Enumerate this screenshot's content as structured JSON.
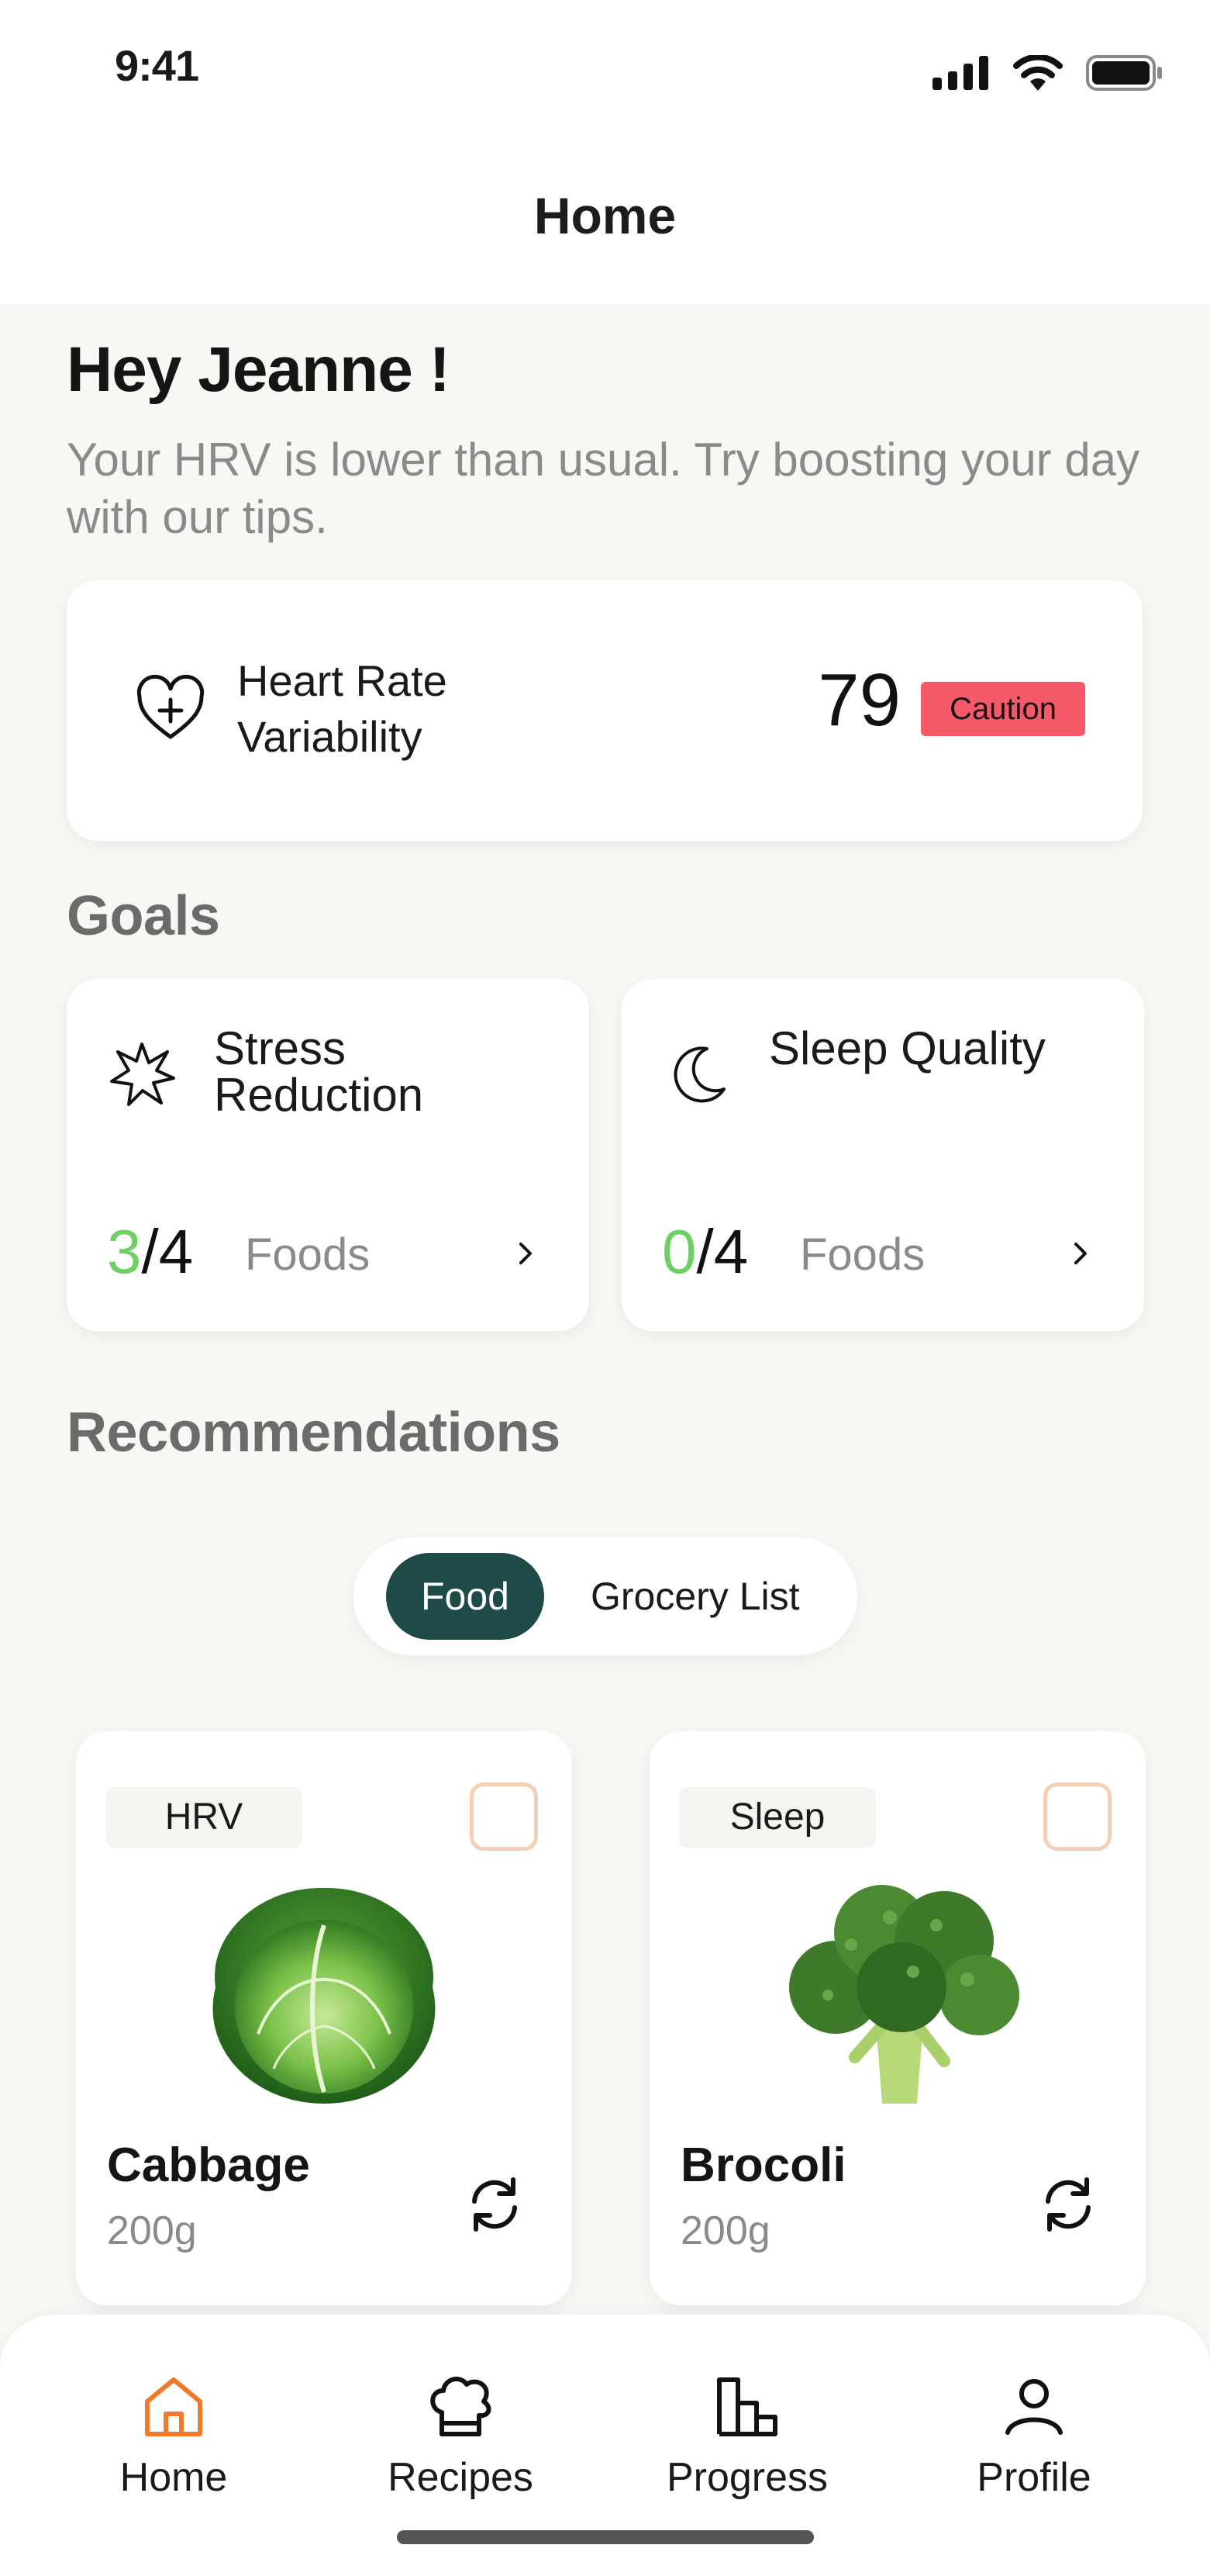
{
  "status_bar": {
    "time": "9:41"
  },
  "header": {
    "title": "Home"
  },
  "greeting": {
    "title": "Hey Jeanne !",
    "message": "Your HRV is lower than usual. Try boosting your day with our tips."
  },
  "hrv": {
    "label": "Heart Rate Variability",
    "value": "79",
    "status": "Caution",
    "status_color": "#f55a6a",
    "icon": "heart-plus-icon"
  },
  "goals": {
    "title": "Goals",
    "items": [
      {
        "name": "Stress Reduction",
        "done": "3",
        "total": "/4",
        "unit": "Foods",
        "icon": "burst-icon"
      },
      {
        "name": "Sleep Quality",
        "done": "0",
        "total": "/4",
        "unit": "Foods",
        "icon": "moon-icon"
      }
    ],
    "done_color": "#6fcf64"
  },
  "recommendations": {
    "title": "Recommendations",
    "tabs": [
      {
        "label": "Food",
        "active": true
      },
      {
        "label": "Grocery List",
        "active": false
      }
    ],
    "accent": "#1e4a48",
    "foods": [
      {
        "tag": "HRV",
        "name": "Cabbage",
        "weight": "200g",
        "icon": "cabbage-image"
      },
      {
        "tag": "Sleep",
        "name": "Brocoli",
        "weight": "200g",
        "icon": "broccoli-image"
      }
    ]
  },
  "bottom_nav": {
    "items": [
      {
        "label": "Home",
        "icon": "home-icon",
        "active": true
      },
      {
        "label": "Recipes",
        "icon": "chef-hat-icon",
        "active": false
      },
      {
        "label": "Progress",
        "icon": "bar-chart-icon",
        "active": false
      },
      {
        "label": "Profile",
        "icon": "user-icon",
        "active": false
      }
    ],
    "active_color": "#f07a2a"
  }
}
